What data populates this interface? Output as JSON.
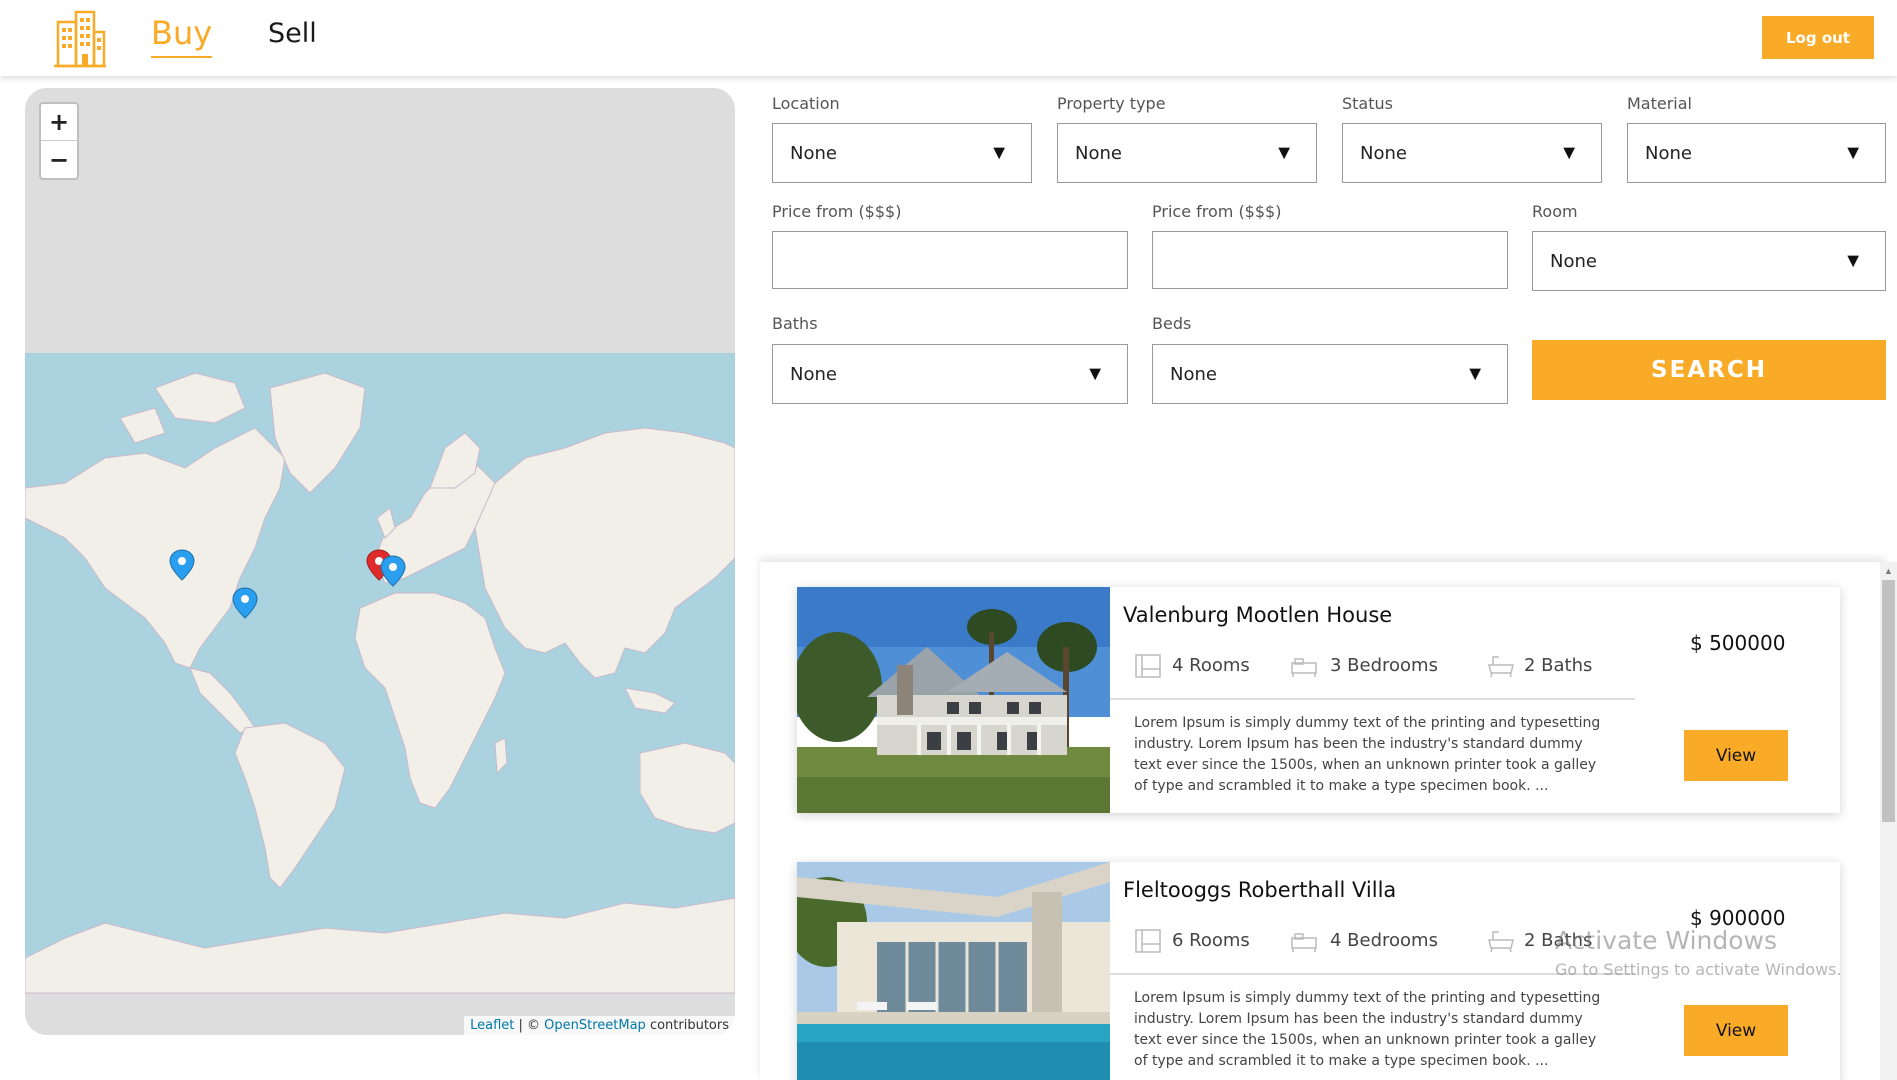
{
  "header": {
    "nav_buy": "Buy",
    "nav_sell": "Sell",
    "logout_label": "Log out",
    "accent_color": "#f9ab27"
  },
  "map": {
    "zoom_in": "+",
    "zoom_out": "−",
    "attribution_leaflet": "Leaflet",
    "attribution_sep": " | © ",
    "attribution_osm": "OpenStreetMap",
    "attribution_suffix": " contributors",
    "markers": [
      {
        "icon": "map-marker-icon",
        "color": "#2a9ff0"
      },
      {
        "icon": "map-marker-icon",
        "color": "#2a9ff0"
      },
      {
        "icon": "map-marker-icon",
        "color": "#e02b2b"
      },
      {
        "icon": "map-marker-icon",
        "color": "#2a9ff0"
      }
    ]
  },
  "filters": {
    "location": {
      "label": "Location",
      "value": "None"
    },
    "property_type": {
      "label": "Property type",
      "value": "None"
    },
    "status": {
      "label": "Status",
      "value": "None"
    },
    "material": {
      "label": "Material",
      "value": "None"
    },
    "price_from_1": {
      "label": "Price from ($$$)",
      "value": ""
    },
    "price_from_2": {
      "label": "Price from ($$$)",
      "value": ""
    },
    "room": {
      "label": "Room",
      "value": "None"
    },
    "baths": {
      "label": "Baths",
      "value": "None"
    },
    "beds": {
      "label": "Beds",
      "value": "None"
    },
    "arrow": "▼",
    "search_label": "SEARCH"
  },
  "listings": [
    {
      "title": "Valenburg Mootlen House",
      "rooms": "4 Rooms",
      "bedrooms": "3 Bedrooms",
      "baths": "2 Baths",
      "price": "$ 500000",
      "description": "Lorem Ipsum is simply dummy text of the printing and typesetting industry. Lorem Ipsum has been the industry's standard dummy text ever since the 1500s, when an unknown printer took a galley of type and scrambled it to make a type specimen book. ...",
      "view_label": "View"
    },
    {
      "title": "Fleltooggs Roberthall Villa",
      "rooms": "6 Rooms",
      "bedrooms": "4 Bedrooms",
      "baths": "2 Baths",
      "price": "$ 900000",
      "description": "Lorem Ipsum is simply dummy text of the printing and typesetting industry. Lorem Ipsum has been the industry's standard dummy text ever since the 1500s, when an unknown printer took a galley of type and scrambled it to make a type specimen book. ...",
      "view_label": "View"
    }
  ],
  "watermark": {
    "line1": "Activate Windows",
    "line2": "Go to Settings to activate Windows."
  }
}
